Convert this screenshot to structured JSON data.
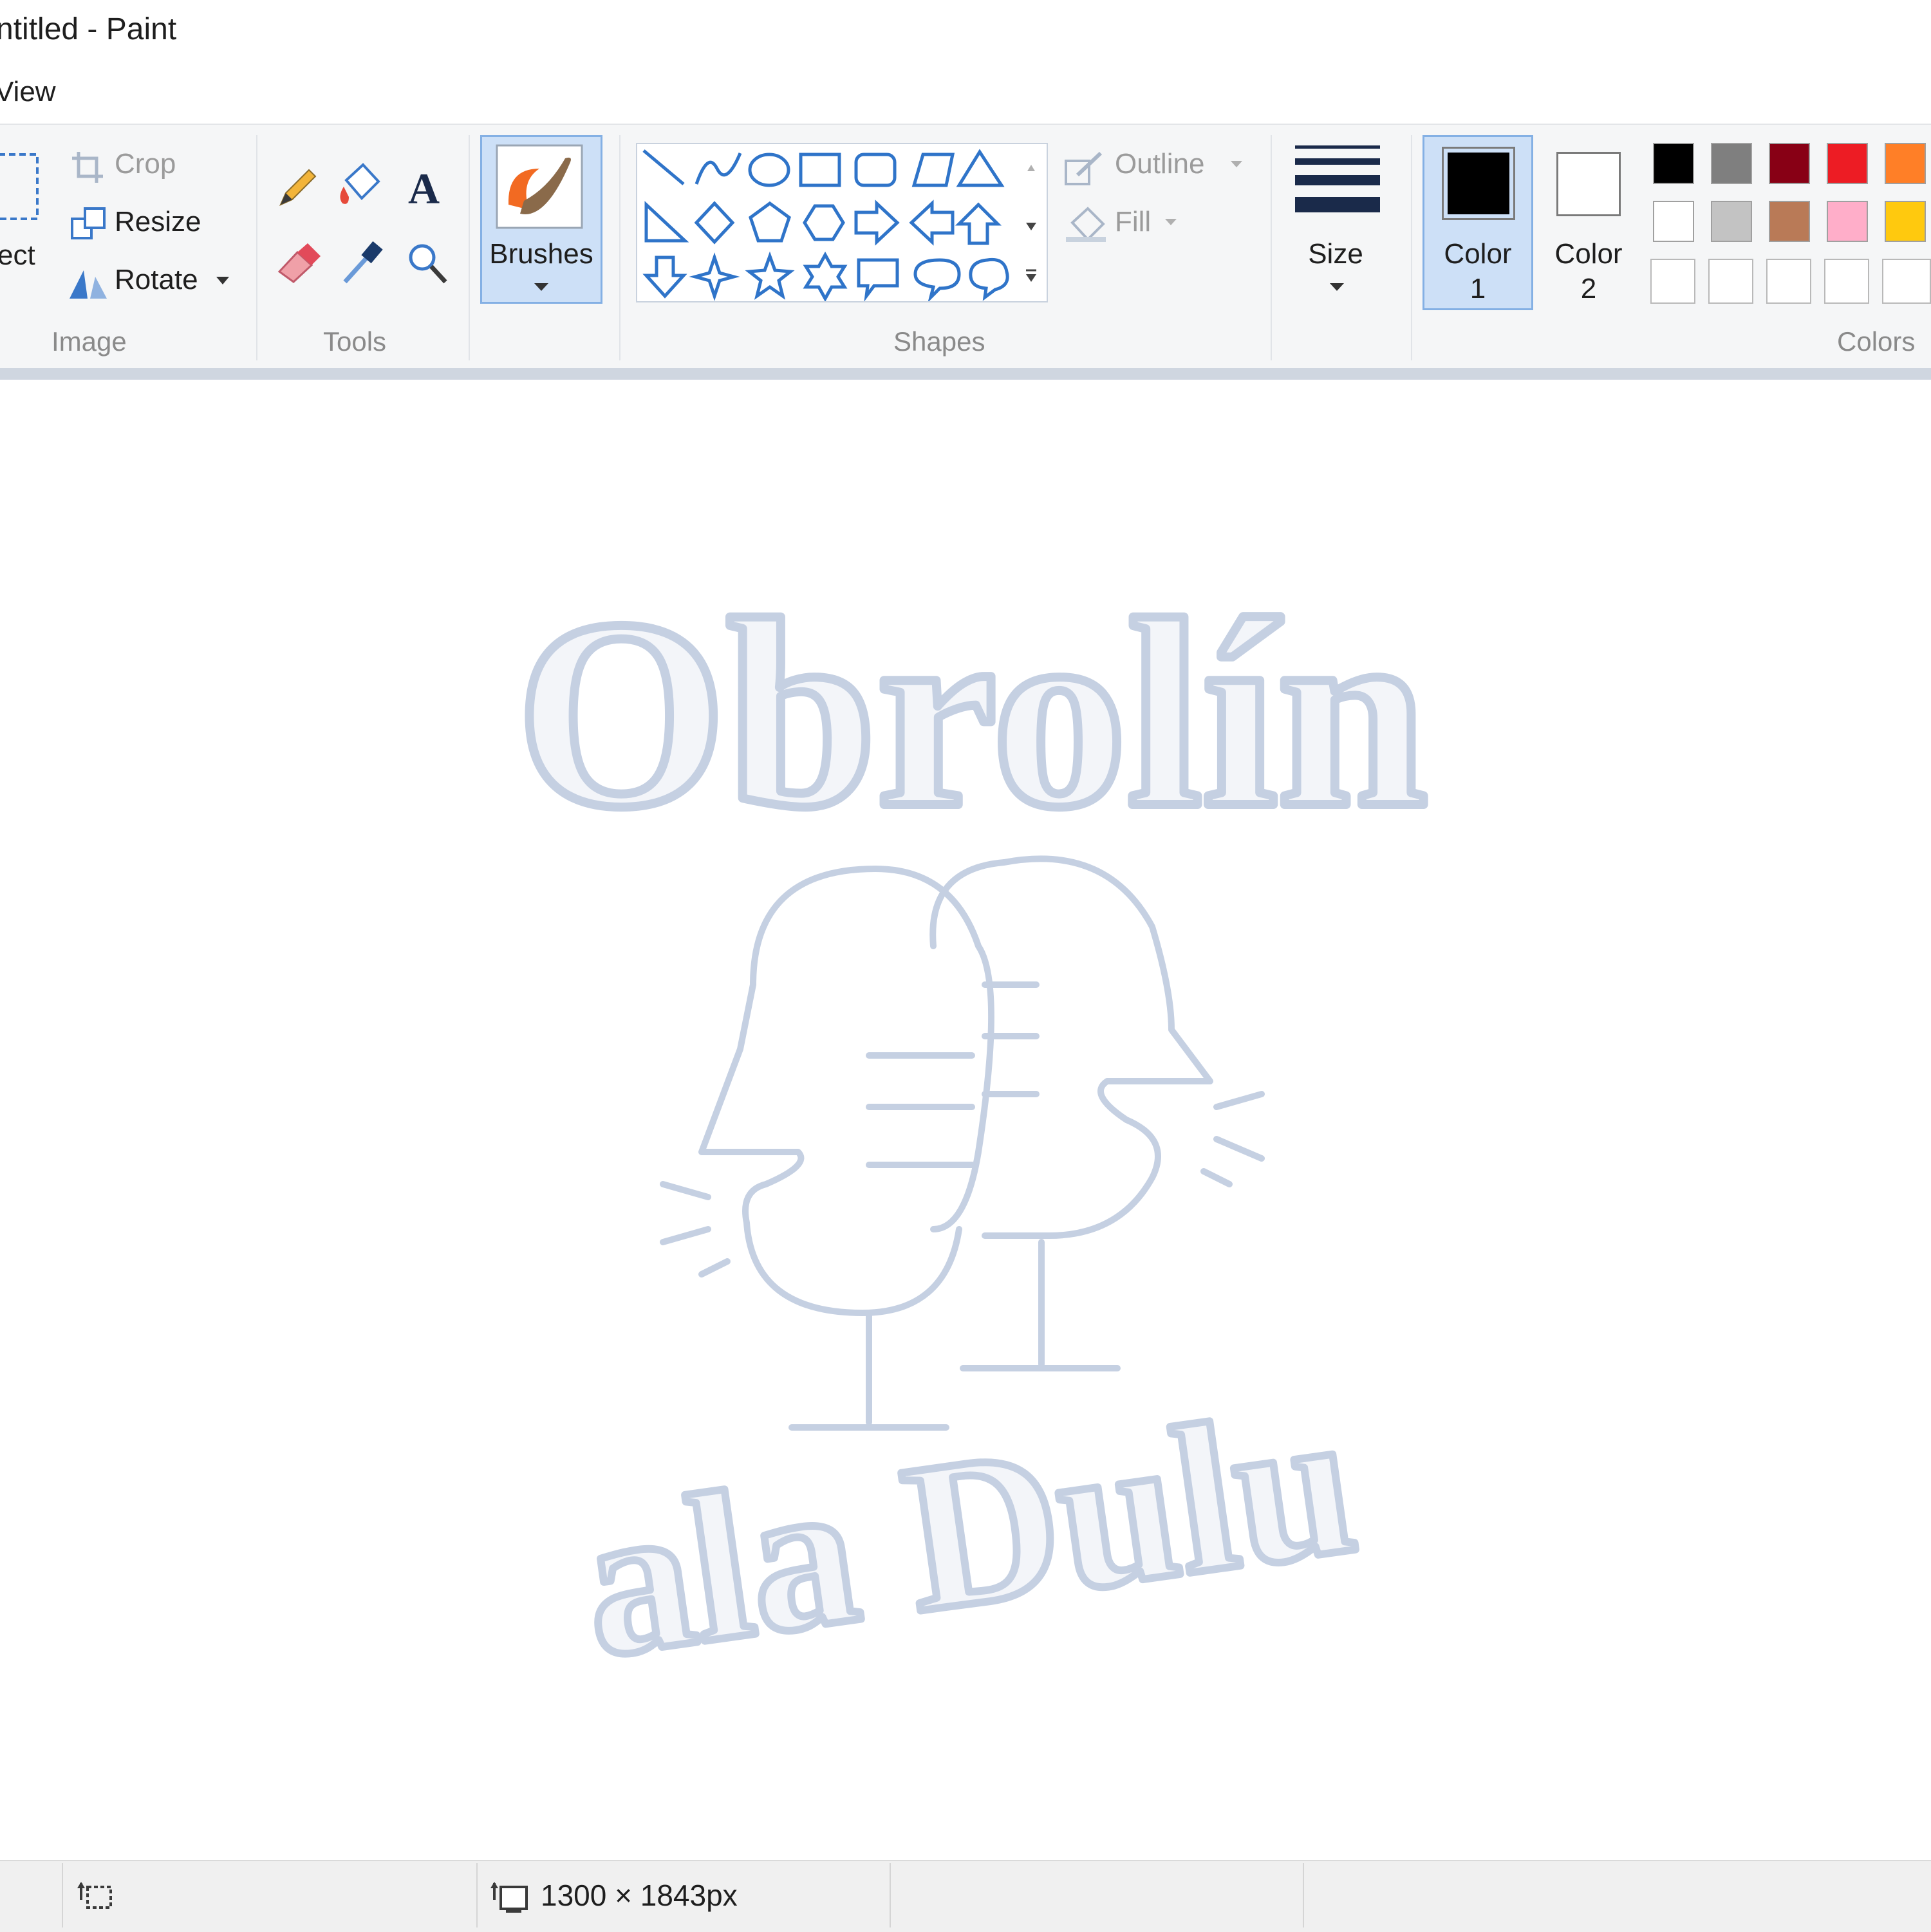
{
  "window": {
    "title": "ntitled - Paint"
  },
  "menu": {
    "view_label": "View"
  },
  "ribbon": {
    "image_group": {
      "select_label": "ect",
      "crop_label": "Crop",
      "resize_label": "Resize",
      "rotate_label": "Rotate",
      "group_label": "Image"
    },
    "tools_group": {
      "group_label": "Tools"
    },
    "brushes_label": "Brushes",
    "shapes_group": {
      "outline_label": "Outline",
      "fill_label": "Fill",
      "group_label": "Shapes"
    },
    "size_label": "Size",
    "color1": {
      "line1": "Color",
      "line2": "1",
      "value": "#000000"
    },
    "color2": {
      "line1": "Color",
      "line2": "2",
      "value": "#ffffff"
    },
    "colors_group_label": "Colors",
    "palette_row1": [
      "#000000",
      "#7f7f7f",
      "#880015",
      "#ed1c24",
      "#ff7f27"
    ],
    "palette_row2": [
      "#ffffff",
      "#c3c3c3",
      "#b97a57",
      "#ffaec9",
      "#ffc90e"
    ]
  },
  "canvas_text": {
    "top_word": "Obrolín",
    "bottom_words": "ala Dulu"
  },
  "status": {
    "image_size": "1300 × 1843px"
  },
  "accent_color": "#cdd8ee",
  "artwork_color": "#c5d0e2"
}
